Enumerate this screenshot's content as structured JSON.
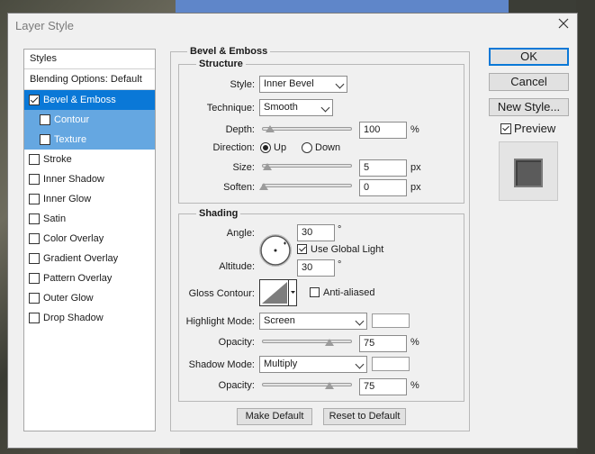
{
  "dialog": {
    "title": "Layer Style"
  },
  "styles_panel": {
    "header": "Styles",
    "blending": "Blending Options: Default",
    "items": [
      {
        "label": "Bevel & Emboss",
        "checked": true
      },
      {
        "label": "Contour",
        "checked": false
      },
      {
        "label": "Texture",
        "checked": false
      },
      {
        "label": "Stroke",
        "checked": false
      },
      {
        "label": "Inner Shadow",
        "checked": false
      },
      {
        "label": "Inner Glow",
        "checked": false
      },
      {
        "label": "Satin",
        "checked": false
      },
      {
        "label": "Color Overlay",
        "checked": false
      },
      {
        "label": "Gradient Overlay",
        "checked": false
      },
      {
        "label": "Pattern Overlay",
        "checked": false
      },
      {
        "label": "Outer Glow",
        "checked": false
      },
      {
        "label": "Drop Shadow",
        "checked": false
      }
    ]
  },
  "bevel": {
    "heading": "Bevel & Emboss",
    "structure": {
      "title": "Structure",
      "style_label": "Style:",
      "style_value": "Inner Bevel",
      "technique_label": "Technique:",
      "technique_value": "Smooth",
      "depth_label": "Depth:",
      "depth_value": "100",
      "depth_unit": "%",
      "direction_label": "Direction:",
      "direction_up": "Up",
      "direction_down": "Down",
      "size_label": "Size:",
      "size_value": "5",
      "size_unit": "px",
      "soften_label": "Soften:",
      "soften_value": "0",
      "soften_unit": "px"
    },
    "shading": {
      "title": "Shading",
      "angle_label": "Angle:",
      "angle_value": "30",
      "angle_unit": "°",
      "global_light_label": "Use Global Light",
      "altitude_label": "Altitude:",
      "altitude_value": "30",
      "altitude_unit": "°",
      "gloss_label": "Gloss Contour:",
      "anti_aliased_label": "Anti-aliased",
      "highlight_mode_label": "Highlight Mode:",
      "highlight_mode_value": "Screen",
      "highlight_opacity_label": "Opacity:",
      "highlight_opacity_value": "75",
      "highlight_opacity_unit": "%",
      "shadow_mode_label": "Shadow Mode:",
      "shadow_mode_value": "Multiply",
      "shadow_opacity_label": "Opacity:",
      "shadow_opacity_value": "75",
      "shadow_opacity_unit": "%"
    },
    "make_default": "Make Default",
    "reset_default": "Reset to Default"
  },
  "buttons": {
    "ok": "OK",
    "cancel": "Cancel",
    "new_style": "New Style...",
    "preview": "Preview"
  },
  "colors": {
    "accent": "#0a78d7",
    "sub_selected": "#65a7e1",
    "dialog_bg": "#f0f0f0"
  }
}
